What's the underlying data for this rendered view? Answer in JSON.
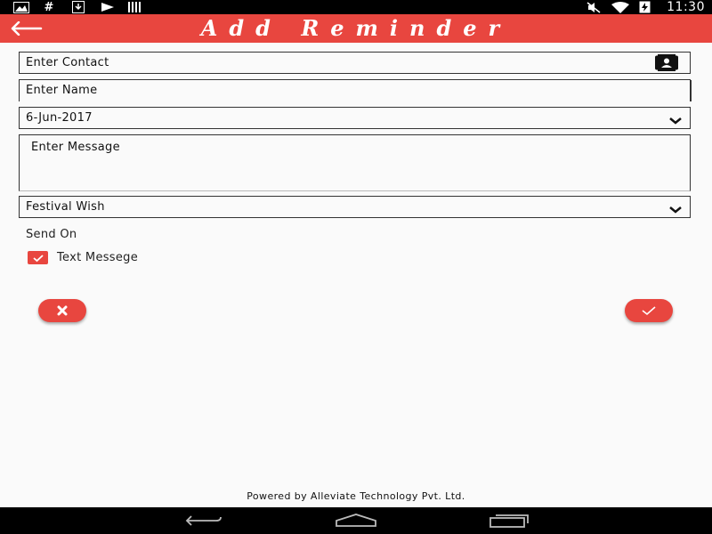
{
  "status_bar": {
    "time": "11:30",
    "icons": [
      "gallery-notification-icon",
      "hash-notification-icon",
      "download-icon",
      "flag-icon",
      "barcode-icon",
      "mute-icon",
      "wifi-icon",
      "battery-charging-icon"
    ]
  },
  "app_bar": {
    "title": "Add Reminder",
    "back_icon": "arrow-left-icon"
  },
  "form": {
    "contact_placeholder": "Enter Contact",
    "contact_icon": "contact-card-icon",
    "name_placeholder": "Enter Name",
    "date_value": "6-Jun-2017",
    "message_placeholder": "Enter Message",
    "type_value": "Festival Wish",
    "send_on_label": "Send On",
    "text_message_label": "Text Messege",
    "text_message_checked": true
  },
  "actions": {
    "cancel_icon": "close-icon",
    "confirm_icon": "check-icon"
  },
  "footer": {
    "text": "Powered by Alleviate Technology Pvt. Ltd."
  },
  "nav_bar": {
    "icons": [
      "back-nav-icon",
      "home-nav-icon",
      "recents-nav-icon"
    ]
  },
  "colors": {
    "accent": "#e8463f",
    "background": "#fafafa"
  }
}
